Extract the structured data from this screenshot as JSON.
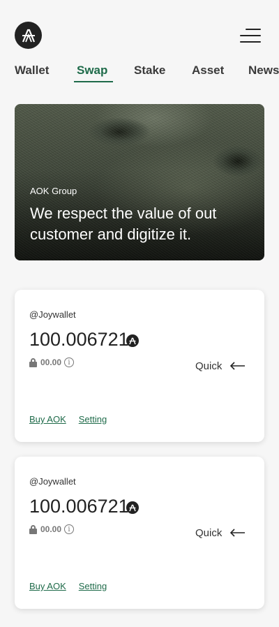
{
  "header": {
    "logo_icon": "aok-logo-icon",
    "menu_icon": "hamburger-menu-icon"
  },
  "tabs": [
    {
      "label": "Wallet",
      "active": false
    },
    {
      "label": "Swap",
      "active": true
    },
    {
      "label": "Stake",
      "active": false
    },
    {
      "label": "Asset",
      "active": false
    },
    {
      "label": "News",
      "active": false
    }
  ],
  "hero": {
    "eyebrow": "AOK Group",
    "text": "We respect the value of out customer and digitize it."
  },
  "cards": [
    {
      "handle": "@Joywallet",
      "balance": "100.006721",
      "locked": "00.00",
      "quick_label": "Quick",
      "links": [
        "Buy AOK",
        "Setting"
      ]
    },
    {
      "handle": "@Joywallet",
      "balance": "100.006721",
      "locked": "00.00",
      "quick_label": "Quick",
      "links": [
        "Buy AOK",
        "Setting"
      ]
    }
  ],
  "colors": {
    "accent": "#1f6b4a",
    "dark": "#222222",
    "background": "#f6f6f6"
  }
}
